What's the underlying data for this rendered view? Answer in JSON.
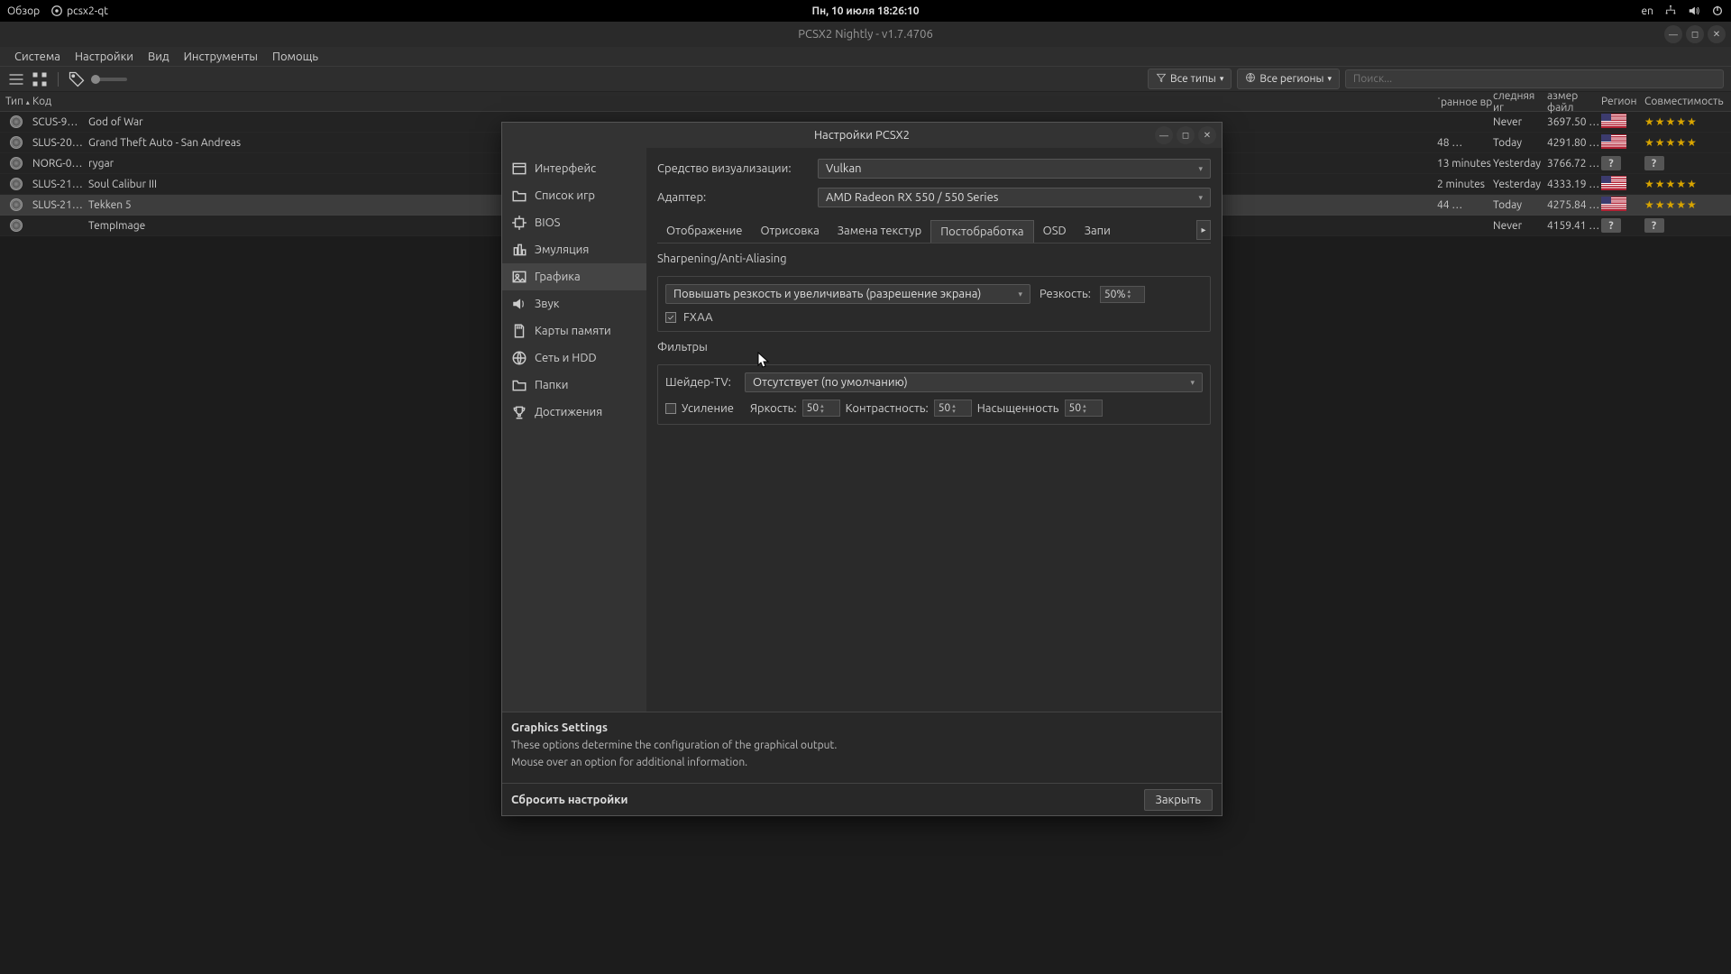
{
  "taskbar": {
    "overview": "Обзор",
    "app": "pcsx2-qt",
    "datetime": "Пн, 10 июля  18:26:10",
    "lang": "en"
  },
  "window": {
    "title": "PCSX2 Nightly - v1.7.4706"
  },
  "menu": {
    "system": "Система",
    "settings": "Настройки",
    "view": "Вид",
    "tools": "Инструменты",
    "help": "Помощь"
  },
  "toolbar": {
    "filter_types": "Все типы",
    "filter_regions": "Все регионы",
    "search_placeholder": "Поиск..."
  },
  "headers": {
    "type": "Тип",
    "code": "Код",
    "fav": "ˈранное вр",
    "last": "следняя иг",
    "size": "азмер файл",
    "region": "Регион",
    "compat": "Совместимость"
  },
  "games": [
    {
      "code": "SCUS-9…",
      "title": "God of War",
      "fav": "",
      "last": "Never",
      "size": "3697.50 …",
      "region": "us",
      "compat": 5
    },
    {
      "code": "SLUS-20…",
      "title": "Grand Theft Auto - San Andreas",
      "fav": "48 …",
      "last": "Today",
      "size": "4291.80 …",
      "region": "us",
      "compat": 5
    },
    {
      "code": "NORG-0…",
      "title": "rygar",
      "fav": "13 minutes",
      "last": "Yesterday",
      "size": "3766.72 …",
      "region": "?",
      "compat": 0
    },
    {
      "code": "SLUS-21…",
      "title": "Soul Calibur III",
      "fav": "2 minutes",
      "last": "Yesterday",
      "size": "4333.19 …",
      "region": "us",
      "compat": 5
    },
    {
      "code": "SLUS-21…",
      "title": "Tekken 5",
      "fav": "44 …",
      "last": "Today",
      "size": "4275.84 …",
      "region": "us",
      "compat": 5
    },
    {
      "code": "",
      "title": "TempImage",
      "fav": "",
      "last": "Never",
      "size": "4159.41 …",
      "region": "?",
      "compat": 0
    }
  ],
  "dialog": {
    "title": "Настройки PCSX2",
    "sidebar": [
      {
        "icon": "window",
        "label": "Интерфейс"
      },
      {
        "icon": "folder",
        "label": "Список игр"
      },
      {
        "icon": "chip",
        "label": "BIOS"
      },
      {
        "icon": "cpu",
        "label": "Эмуляция"
      },
      {
        "icon": "image",
        "label": "Графика"
      },
      {
        "icon": "speaker",
        "label": "Звук"
      },
      {
        "icon": "sd",
        "label": "Карты памяти"
      },
      {
        "icon": "globe",
        "label": "Сеть и HDD"
      },
      {
        "icon": "folder2",
        "label": "Папки"
      },
      {
        "icon": "trophy",
        "label": "Достижения"
      }
    ],
    "renderer_label": "Средство визуализации:",
    "renderer_value": "Vulkan",
    "adapter_label": "Адаптер:",
    "adapter_value": "AMD Radeon RX 550 / 550 Series",
    "tabs": {
      "display": "Отображение",
      "rendering": "Отрисовка",
      "texrep": "Замена текстур",
      "post": "Постобработка",
      "osd": "OSD",
      "rec": "Запи"
    },
    "sharp_group": "Sharpening/Anti-Aliasing",
    "sharpen_mode": "Повышать резкость и увеличивать (разрешение экрана)",
    "sharpness_label": "Резкость:",
    "sharpness_value": "50%",
    "fxaa_label": "FXAA",
    "filters_group": "Фильтры",
    "shader_label": "Шейдер-TV:",
    "shader_value": "Отсутствует (по умолчанию)",
    "boost_label": "Усиление",
    "brightness_label": "Яркость:",
    "brightness_value": "50",
    "contrast_label": "Контрастность:",
    "contrast_value": "50",
    "saturation_label": "Насыщенность",
    "saturation_value": "50",
    "desc_heading": "Graphics Settings",
    "desc_p1": "These options determine the configuration of the graphical output.",
    "desc_p2": "Mouse over an option for additional information.",
    "reset": "Сбросить настройки",
    "close": "Закрыть"
  }
}
